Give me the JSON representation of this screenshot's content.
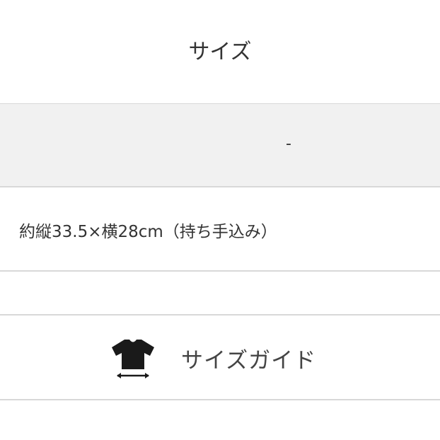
{
  "title": "サイズ",
  "header_row": {
    "value": "-"
  },
  "size_row": {
    "text": "約縦33.5×横28cm（持ち手込み）"
  },
  "size_guide": {
    "label": "サイズガイド",
    "icon": "tshirt-size-icon"
  }
}
